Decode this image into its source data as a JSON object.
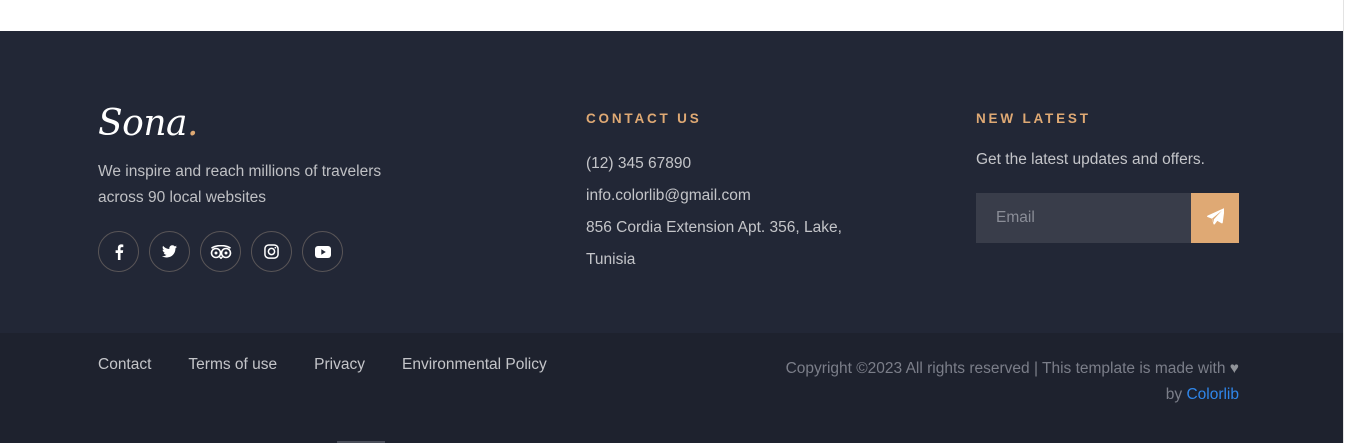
{
  "brand": {
    "name": "Sona",
    "dot": ".",
    "description_line1": "We inspire and reach millions of travelers",
    "description_line2": "across 90 local websites",
    "accent_color": "#dfa974"
  },
  "social_icons": [
    "facebook-icon",
    "twitter-icon",
    "tripadvisor-icon",
    "instagram-icon",
    "youtube-icon"
  ],
  "contact": {
    "heading": "CONTACT US",
    "phone": "(12) 345 67890",
    "email": "info.colorlib@gmail.com",
    "address_line1": "856 Cordia Extension Apt. 356, Lake,",
    "address_line2": "Tunisia"
  },
  "newsletter": {
    "heading": "NEW LATEST",
    "text": "Get the latest updates and offers.",
    "email_placeholder": "Email",
    "send_icon": "paper-plane-icon"
  },
  "bottom_links": [
    "Contact",
    "Terms of use",
    "Privacy",
    "Environmental Policy"
  ],
  "copyright": {
    "text": "Copyright ©2023 All rights reserved | This template is made with",
    "heart": "♥",
    "by": "by",
    "link_text": "Colorlib",
    "link_color": "#2f86ea"
  }
}
